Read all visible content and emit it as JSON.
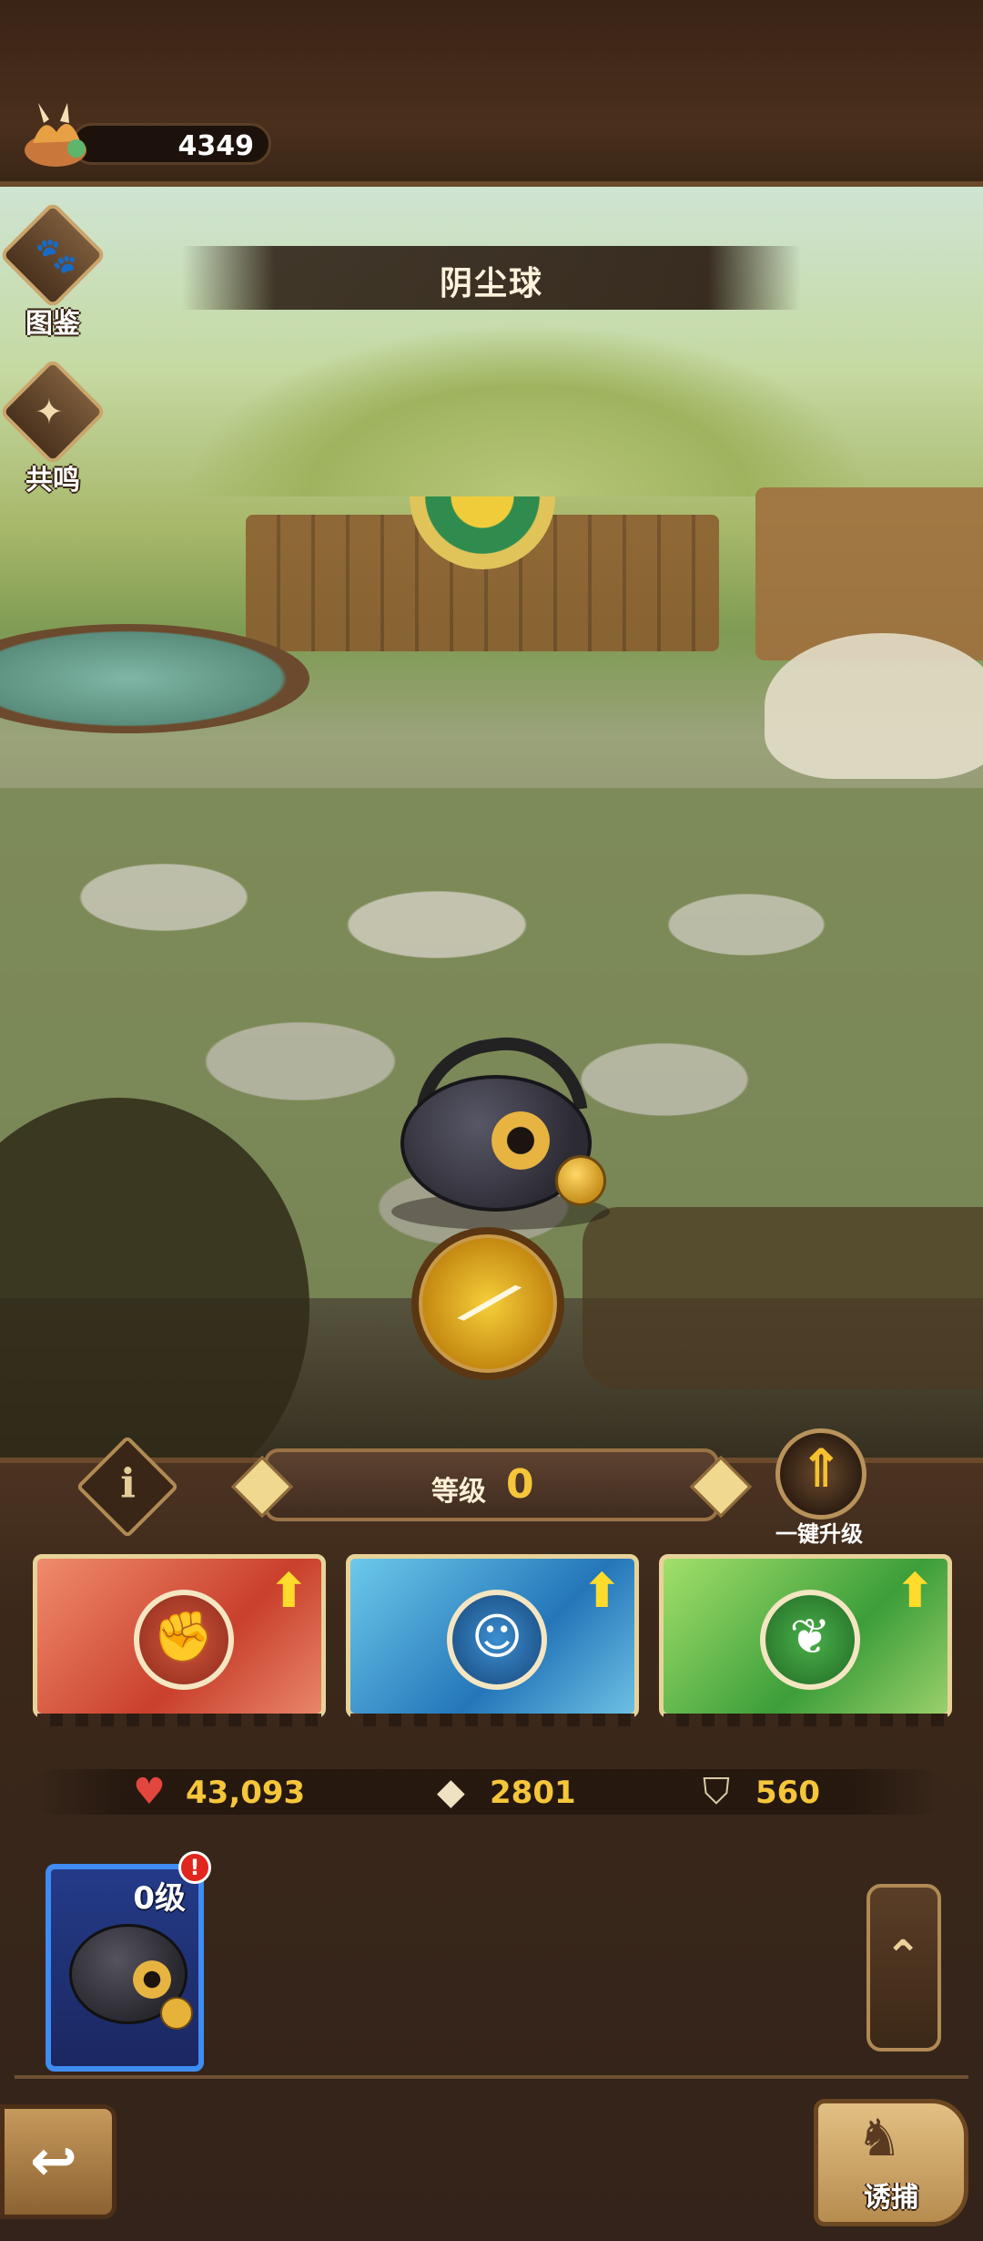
{
  "topbar": {
    "currency": {
      "icon": "resource-icon",
      "value": "4349"
    }
  },
  "scene": {
    "creature_name": "阴尘球"
  },
  "side_menu": {
    "items": [
      {
        "label": "图鉴",
        "icon": "paw-scroll-icon",
        "glyph": "🐾"
      },
      {
        "label": "共鸣",
        "icon": "resonance-icon",
        "glyph": "✦"
      }
    ]
  },
  "skill_badge": {
    "icon": "slash-skill-icon",
    "glyph": "⟋"
  },
  "panel": {
    "info_glyph": "i",
    "level": {
      "label": "等级",
      "value": "0"
    },
    "one_click_upgrade": {
      "label": "一键升级",
      "glyph": "⇑"
    },
    "upgrade_cards": [
      {
        "type": "attack",
        "color": "#d34a33",
        "glyph": "✊",
        "up": "⬆"
      },
      {
        "type": "spirit",
        "color": "#2f86c7",
        "glyph": "☺",
        "up": "⬆"
      },
      {
        "type": "nature",
        "color": "#3da33d",
        "glyph": "❦",
        "up": "⬆"
      }
    ],
    "stats": {
      "hp": {
        "icon": "heart-icon",
        "glyph": "♥",
        "value": "43,093"
      },
      "attack": {
        "icon": "crystal-icon",
        "glyph": "◆",
        "value": "2801"
      },
      "defense": {
        "icon": "shield-icon",
        "glyph": "⛉",
        "value": "560"
      }
    },
    "pet_slot": {
      "level_label": "0级",
      "alert": "!"
    },
    "scroll_up_glyph": "⌃"
  },
  "footer": {
    "back_glyph": "↩",
    "lure": {
      "label": "诱捕",
      "glyph": "♞"
    }
  }
}
